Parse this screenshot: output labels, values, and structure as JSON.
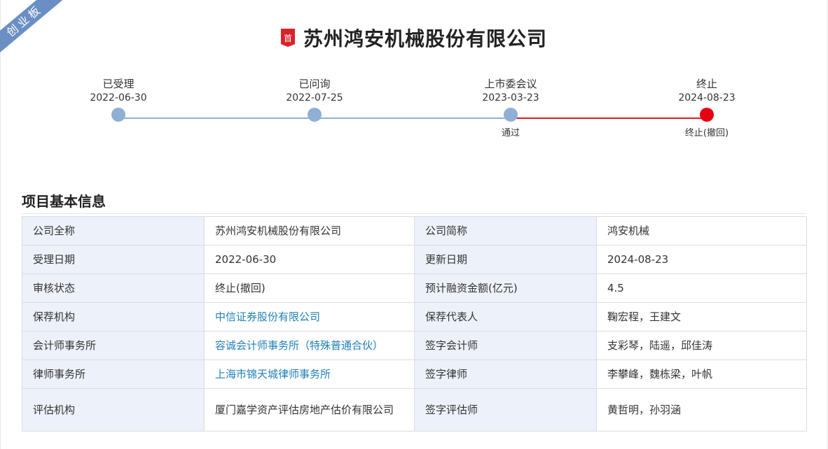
{
  "ribbon": "创业板",
  "header": {
    "badge": "首",
    "company_name": "苏州鸿安机械股份有限公司"
  },
  "timeline": [
    {
      "label": "已受理",
      "date": "2022-06-30",
      "status": ""
    },
    {
      "label": "已问询",
      "date": "2022-07-25",
      "status": ""
    },
    {
      "label": "上市委会议",
      "date": "2023-03-23",
      "status": "通过"
    },
    {
      "label": "终止",
      "date": "2024-08-23",
      "status": "终止(撤回)"
    }
  ],
  "section": {
    "title": "项目基本信息"
  },
  "info": {
    "rows": [
      {
        "l1": "公司全称",
        "v1": "苏州鸿安机械股份有限公司",
        "l2": "公司简称",
        "v2": "鸿安机械"
      },
      {
        "l1": "受理日期",
        "v1": "2022-06-30",
        "l2": "更新日期",
        "v2": "2024-08-23"
      },
      {
        "l1": "审核状态",
        "v1": "终止(撤回)",
        "l2": "预计融资金额(亿元)",
        "v2": "4.5"
      },
      {
        "l1": "保荐机构",
        "v1": "中信证券股份有限公司",
        "l2": "保荐代表人",
        "v2": "鞠宏程，王建文"
      },
      {
        "l1": "会计师事务所",
        "v1": "容诚会计师事务所（特殊普通合伙）",
        "l2": "签字会计师",
        "v2": "支彩琴，陆遥，邱佳涛"
      },
      {
        "l1": "律师事务所",
        "v1": "上海市锦天城律师事务所",
        "l2": "签字律师",
        "v2": "李攀峰，魏栋梁，叶帆"
      },
      {
        "l1": "评估机构",
        "v1": "厦门嘉学资产评估房地产估价有限公司",
        "l2": "签字评估师",
        "v2": "黄哲明，孙羽涵"
      }
    ]
  },
  "colors": {
    "accent_blue": "#8fb0d4",
    "terminated_red": "#e60012",
    "label_bg": "#edf1f9",
    "link": "#1f7fb9",
    "ribbon": "#6b8fc4"
  }
}
